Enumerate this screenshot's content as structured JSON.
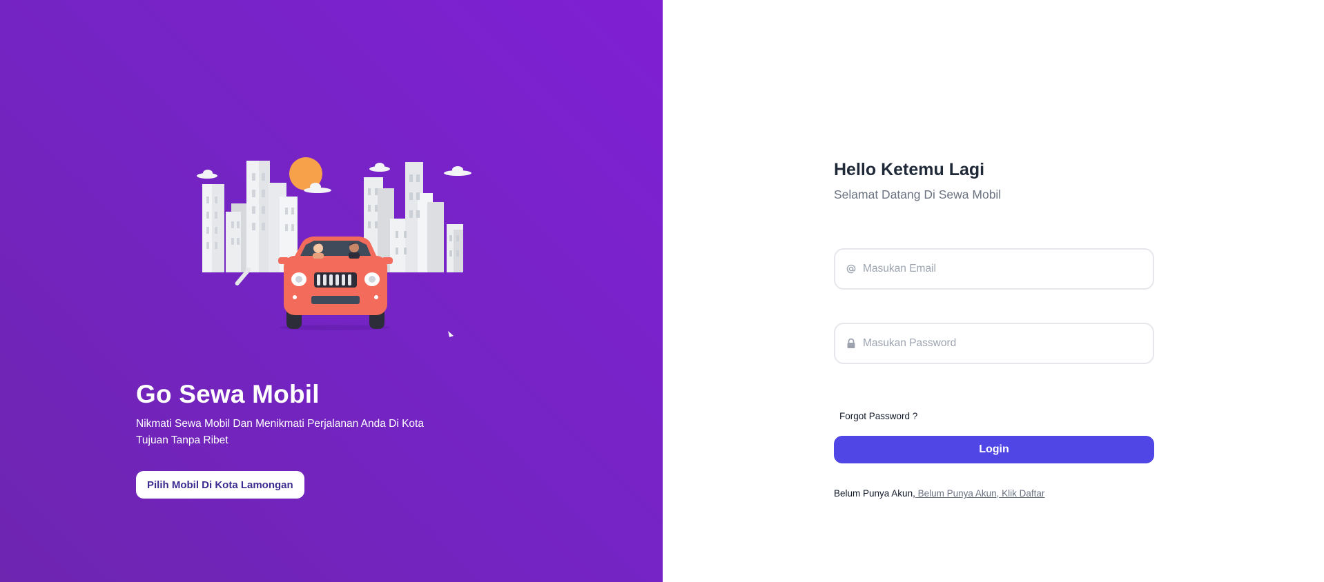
{
  "hero": {
    "title": "Go Sewa Mobil",
    "subtitle": "Nikmati Sewa Mobil Dan Menikmati Perjalanan Anda Di Kota Tujuan Tanpa Ribet",
    "cta_label": "Pilih Mobil Di Kota Lamongan"
  },
  "login": {
    "title": "Hello Ketemu Lagi",
    "subtitle": "Selamat Datang Di Sewa Mobil",
    "email_placeholder": "Masukan Email",
    "password_placeholder": "Masukan Password",
    "forgot_label": "Forgot Password ?",
    "submit_label": "Login",
    "signup_prefix": "Belum Punya Akun,",
    "signup_link": " Belum Punya Akun, Klik Daftar"
  },
  "icons": {
    "email": "at-icon",
    "password": "lock-icon"
  },
  "colors": {
    "hero_gradient_start": "#7f20d3",
    "hero_gradient_end": "#6e25b0",
    "primary": "#4f46e5",
    "car": "#f26b5b",
    "sun": "#f7a14a"
  }
}
